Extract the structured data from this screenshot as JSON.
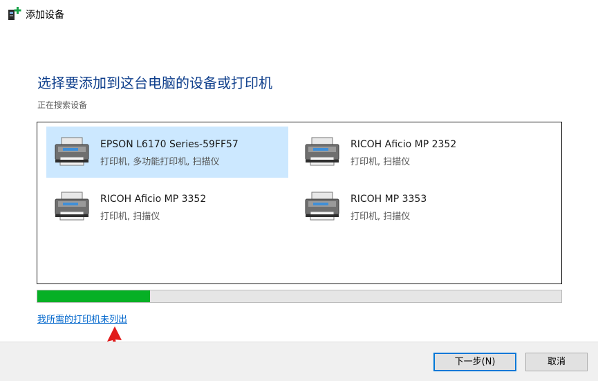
{
  "window": {
    "title": "添加设备",
    "icon": "add-device-printer-icon"
  },
  "main": {
    "heading": "选择要添加到这台电脑的设备或打印机",
    "status": "正在搜索设备"
  },
  "devices": [
    {
      "name": "EPSON L6170 Series-59FF57",
      "type": "打印机, 多功能打印机, 扫描仪",
      "selected": true,
      "icon": "printer-icon"
    },
    {
      "name": "RICOH Aficio MP 2352",
      "type": "打印机, 扫描仪",
      "selected": false,
      "icon": "printer-icon"
    },
    {
      "name": "RICOH Aficio MP 3352",
      "type": "打印机, 扫描仪",
      "selected": false,
      "icon": "printer-icon"
    },
    {
      "name": "RICOH MP 3353",
      "type": "打印机, 扫描仪",
      "selected": false,
      "icon": "printer-icon"
    }
  ],
  "progress": {
    "fraction": 0.215,
    "color": "#06b025"
  },
  "link": {
    "text": "我所需的打印机未列出"
  },
  "annotation": {
    "arrow_color": "#e11b1b",
    "icon": "red-arrow-up-icon"
  },
  "footer": {
    "next_label": "下一步(N)",
    "cancel_label": "取消"
  },
  "colors": {
    "heading": "#0f3f8c",
    "selection": "#cce8ff",
    "link": "#0066cc"
  }
}
